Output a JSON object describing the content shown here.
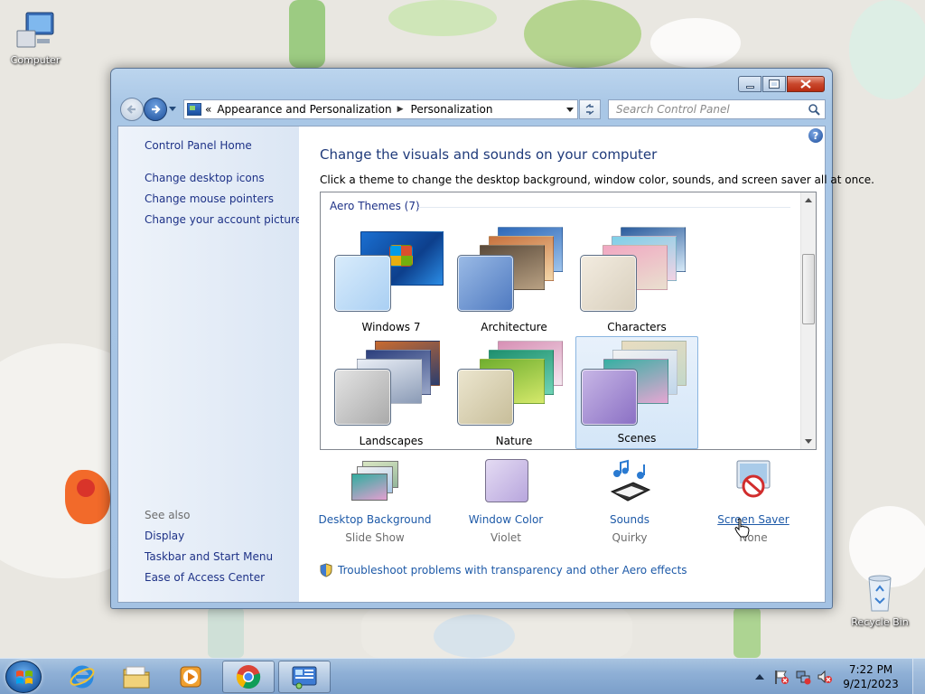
{
  "desktop": {
    "icons": [
      {
        "label": "Computer"
      },
      {
        "label": "Recycle Bin"
      }
    ]
  },
  "window": {
    "address": {
      "overflow": "«",
      "segments": [
        "Appearance and Personalization",
        "Personalization"
      ]
    },
    "search_placeholder": "Search Control Panel",
    "sidebar": {
      "home": "Control Panel Home",
      "links": [
        "Change desktop icons",
        "Change mouse pointers",
        "Change your account picture"
      ],
      "see_also_heading": "See also",
      "see_also": [
        "Display",
        "Taskbar and Start Menu",
        "Ease of Access Center"
      ]
    },
    "main": {
      "title": "Change the visuals and sounds on your computer",
      "description": "Click a theme to change the desktop background, window color, sounds, and screen saver all at once.",
      "group_heading": "Aero Themes (7)",
      "themes": [
        {
          "name": "Windows 7",
          "selected": false
        },
        {
          "name": "Architecture",
          "selected": false
        },
        {
          "name": "Characters",
          "selected": false
        },
        {
          "name": "Landscapes",
          "selected": false
        },
        {
          "name": "Nature",
          "selected": false
        },
        {
          "name": "Scenes",
          "selected": true
        }
      ],
      "settings": [
        {
          "label": "Desktop Background",
          "value": "Slide Show"
        },
        {
          "label": "Window Color",
          "value": "Violet"
        },
        {
          "label": "Sounds",
          "value": "Quirky"
        },
        {
          "label": "Screen Saver",
          "value": "None"
        }
      ],
      "troubleshoot": "Troubleshoot problems with transparency and other Aero effects"
    }
  },
  "taskbar": {
    "time": "7:22 PM",
    "date": "9/21/2023"
  },
  "colors": {
    "link": "#1e5aa8",
    "sidebar_link": "#1e3287",
    "title": "#1f3a7a",
    "selection": "#d4e6f8"
  }
}
